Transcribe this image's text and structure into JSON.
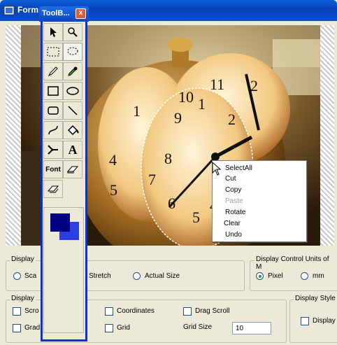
{
  "window": {
    "title": "Form"
  },
  "toolbox": {
    "title": "ToolB...",
    "close_label": "x",
    "font_label": "Font",
    "text_tool_label": "A",
    "tools": [
      "pointer-icon",
      "zoom-icon",
      "rect-select-icon",
      "lasso-select-icon",
      "pencil-icon",
      "eyedropper-icon",
      "rectangle-icon",
      "ellipse-icon",
      "rounded-rect-icon",
      "line-icon",
      "curve-icon",
      "paint-bucket-icon",
      "airbrush-icon",
      "text-icon",
      "font-icon",
      "eraser-icon",
      "clear-icon"
    ],
    "foreground_color": "#000080",
    "background_color": "#2a3fe0"
  },
  "context_menu": {
    "items": [
      {
        "label": "SelectAll",
        "enabled": true
      },
      {
        "label": "Cut",
        "enabled": true
      },
      {
        "label": "Copy",
        "enabled": true
      },
      {
        "label": "Paste",
        "enabled": false
      },
      {
        "label": "Rotate",
        "enabled": true
      },
      {
        "label": "Clear",
        "enabled": true
      },
      {
        "label": "Undo",
        "enabled": true
      }
    ]
  },
  "display_group": {
    "label": "Display",
    "options": {
      "scale": "Sca",
      "stretch": "Stretch",
      "actual": "Actual Size"
    }
  },
  "units_group": {
    "label": "Display Control Units of M",
    "options": {
      "pixel": "Pixel",
      "mm": "mm"
    },
    "selected": "Pixel"
  },
  "display2_group": {
    "label": "Display",
    "checks": {
      "scroll": "Scro",
      "grad": "Grad",
      "coordinates": "Coordinates",
      "grid": "Grid",
      "drag_scroll": "Drag Scroll"
    },
    "grid_size_label": "Grid Size",
    "grid_size_value": "10"
  },
  "style_group": {
    "label": "Display Style",
    "checks": {
      "display": "Display"
    }
  }
}
